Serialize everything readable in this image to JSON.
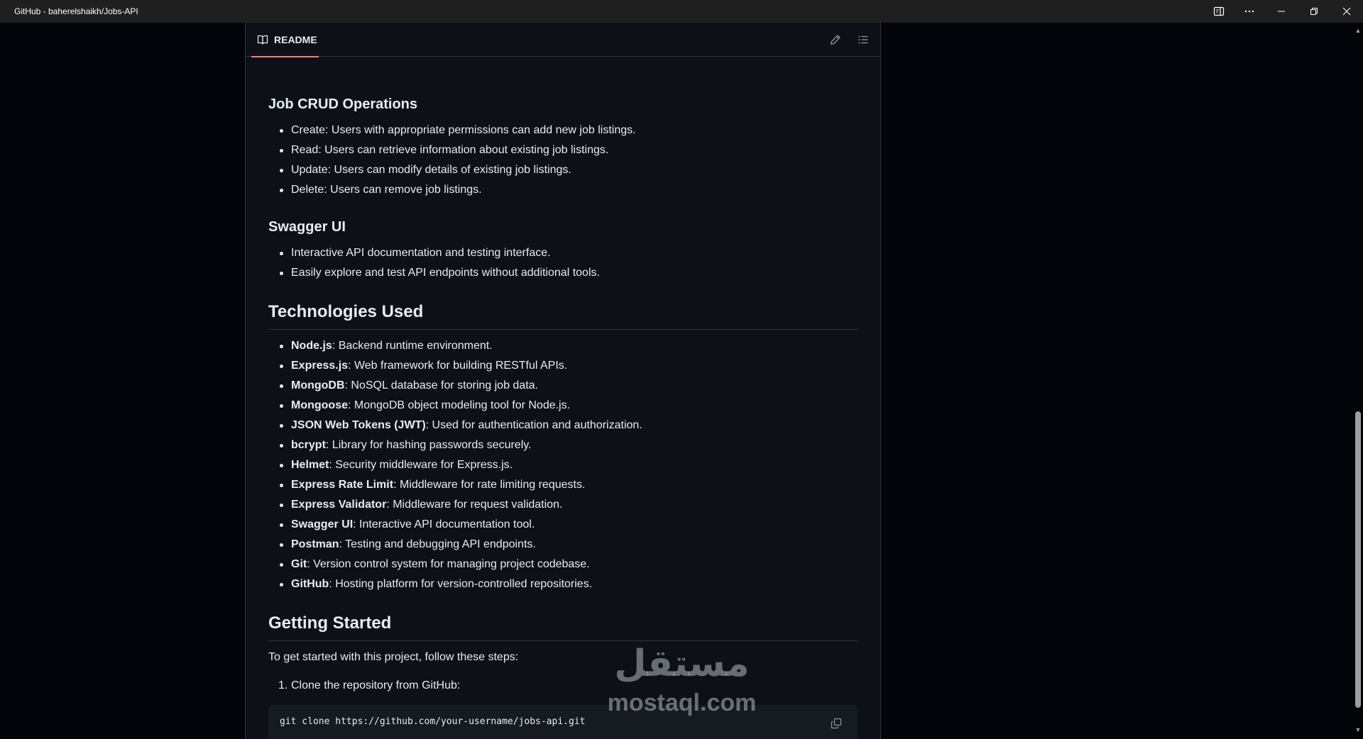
{
  "window": {
    "title": "GitHub - baherelshaikh/Jobs-API"
  },
  "readme": {
    "tab_label": "README"
  },
  "crud": {
    "heading": "Job CRUD Operations",
    "items": [
      "Create: Users with appropriate permissions can add new job listings.",
      "Read: Users can retrieve information about existing job listings.",
      "Update: Users can modify details of existing job listings.",
      "Delete: Users can remove job listings."
    ]
  },
  "swagger": {
    "heading": "Swagger UI",
    "items": [
      "Interactive API documentation and testing interface.",
      "Easily explore and test API endpoints without additional tools."
    ]
  },
  "technologies": {
    "heading": "Technologies Used",
    "items": [
      {
        "name": "Node.js",
        "desc": ": Backend runtime environment."
      },
      {
        "name": "Express.js",
        "desc": ": Web framework for building RESTful APIs."
      },
      {
        "name": "MongoDB",
        "desc": ": NoSQL database for storing job data."
      },
      {
        "name": "Mongoose",
        "desc": ": MongoDB object modeling tool for Node.js."
      },
      {
        "name": "JSON Web Tokens (JWT)",
        "desc": ": Used for authentication and authorization."
      },
      {
        "name": "bcrypt",
        "desc": ": Library for hashing passwords securely."
      },
      {
        "name": "Helmet",
        "desc": ": Security middleware for Express.js."
      },
      {
        "name": "Express Rate Limit",
        "desc": ": Middleware for rate limiting requests."
      },
      {
        "name": "Express Validator",
        "desc": ": Middleware for request validation."
      },
      {
        "name": "Swagger UI",
        "desc": ": Interactive API documentation tool."
      },
      {
        "name": "Postman",
        "desc": ": Testing and debugging API endpoints."
      },
      {
        "name": "Git",
        "desc": ": Version control system for managing project codebase."
      },
      {
        "name": "GitHub",
        "desc": ": Hosting platform for version-controlled repositories."
      }
    ]
  },
  "getting_started": {
    "heading": "Getting Started",
    "intro": "To get started with this project, follow these steps:",
    "steps": [
      {
        "num": "1.",
        "text": "Clone the repository from GitHub:"
      }
    ],
    "code": "git clone https://github.com/your-username/jobs-api.git"
  },
  "watermark": {
    "arabic": "مستقل",
    "latin": "mostaql.com"
  },
  "icons": {
    "book": "book-icon",
    "edit": "pencil-icon",
    "outline": "list-unordered-icon",
    "copy": "copy-icon"
  }
}
